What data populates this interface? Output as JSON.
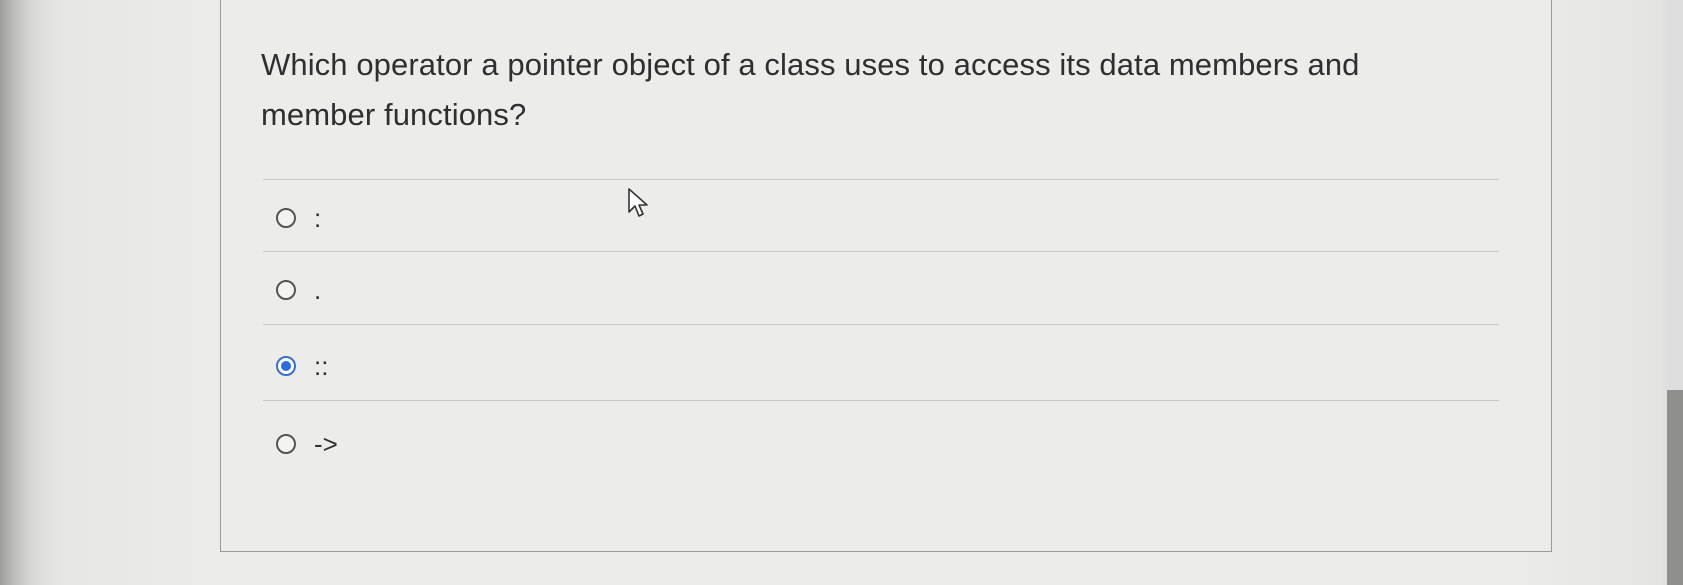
{
  "question": {
    "text": "Which operator a pointer object of a class uses to access its data members and member functions?"
  },
  "options": [
    {
      "label": ":",
      "selected": false
    },
    {
      "label": ".",
      "selected": false
    },
    {
      "label": "::",
      "selected": true
    },
    {
      "label": "->",
      "selected": false
    }
  ],
  "colors": {
    "selected_radio": "#2d6ae0",
    "text": "#2f2f2f"
  },
  "icons": {
    "cursor": "pointer-cursor-icon"
  }
}
